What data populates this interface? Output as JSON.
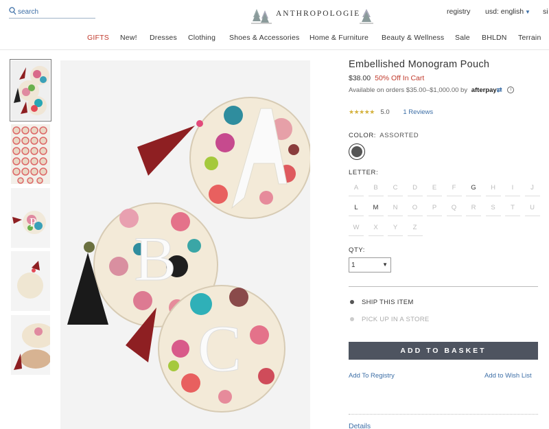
{
  "header": {
    "search_placeholder": "search",
    "logo": "ANTHROPOLOGIE",
    "registry": "registry",
    "currency": "usd: english",
    "signin": "si"
  },
  "nav": [
    "GIFTS",
    "New!",
    "Dresses",
    "Clothing",
    "Shoes & Accessories",
    "Home & Furniture",
    "Beauty & Wellness",
    "Sale",
    "BHLDN",
    "Terrain"
  ],
  "product": {
    "title": "Embellished Monogram Pouch",
    "price": "$38.00",
    "discount": "50% Off In Cart",
    "availability": "Available on orders $35.00–$1,000.00 by",
    "afterpay": "afterpay",
    "info_icon": "i",
    "stars": "★★★★★",
    "rating": "5.0",
    "reviews": "1 Reviews",
    "color_label": "COLOR:",
    "color_value": "ASSORTED",
    "letter_label": "LETTER:",
    "letters": [
      "A",
      "B",
      "C",
      "D",
      "E",
      "F",
      "G",
      "H",
      "I",
      "J",
      "L",
      "M",
      "N",
      "O",
      "P",
      "Q",
      "R",
      "S",
      "T",
      "U",
      "W",
      "X",
      "Y",
      "Z"
    ],
    "available_letters": [
      "G",
      "L",
      "M"
    ],
    "qty_label": "QTY:",
    "qty_value": "1",
    "ship_option": "SHIP THIS ITEM",
    "pickup_option": "PICK UP IN A STORE",
    "add_to_basket": "ADD TO BASKET",
    "add_to_registry": "Add To Registry",
    "add_to_wishlist": "Add to Wish List",
    "details": "Details"
  },
  "colors": {
    "accent_red": "#c0392b",
    "link_blue": "#3c6ea6",
    "button": "#4e5460"
  }
}
